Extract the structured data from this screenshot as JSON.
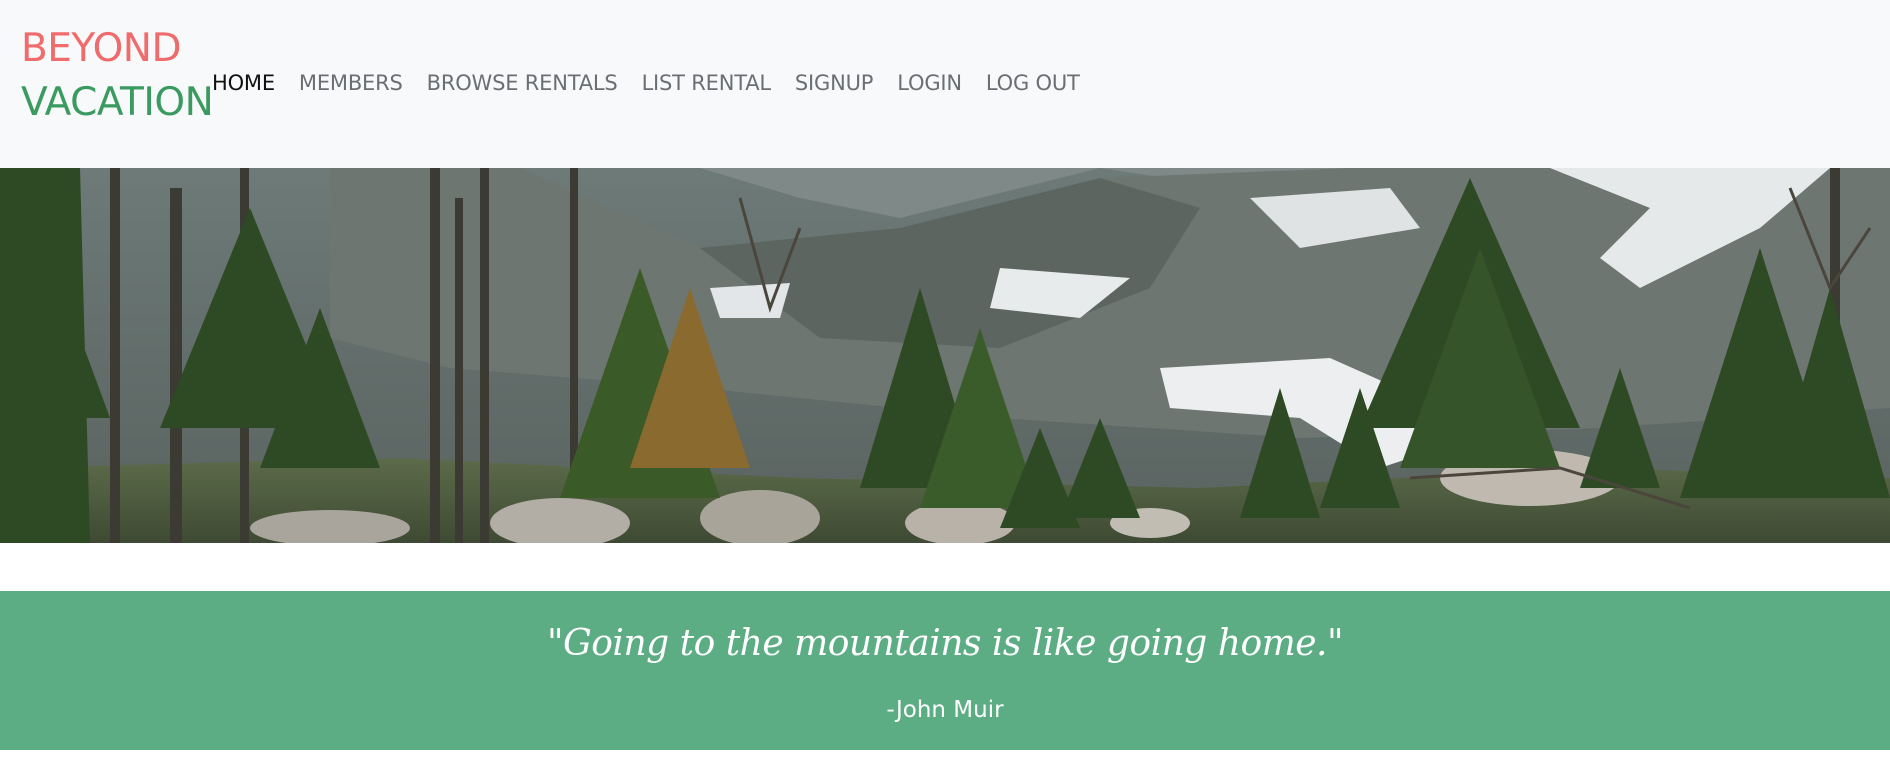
{
  "brand": {
    "line1": "BEYOND",
    "line2": "VACATION"
  },
  "nav": {
    "items": [
      {
        "label": "HOME",
        "active": true
      },
      {
        "label": "MEMBERS"
      },
      {
        "label": "BROWSE RENTALS"
      },
      {
        "label": "LIST RENTAL"
      },
      {
        "label": "SIGNUP"
      },
      {
        "label": "LOGIN"
      },
      {
        "label": "LOG OUT"
      }
    ]
  },
  "hero": {
    "image": "mountain-forest-landscape"
  },
  "quote": {
    "text": "\"Going to the mountains is like going home.\"",
    "author": "-John Muir"
  },
  "colors": {
    "brand_primary": "#f06b6b",
    "brand_secondary": "#3a9a5f",
    "navbar_bg": "#f8f9fa",
    "quote_bg": "#5cad84"
  }
}
